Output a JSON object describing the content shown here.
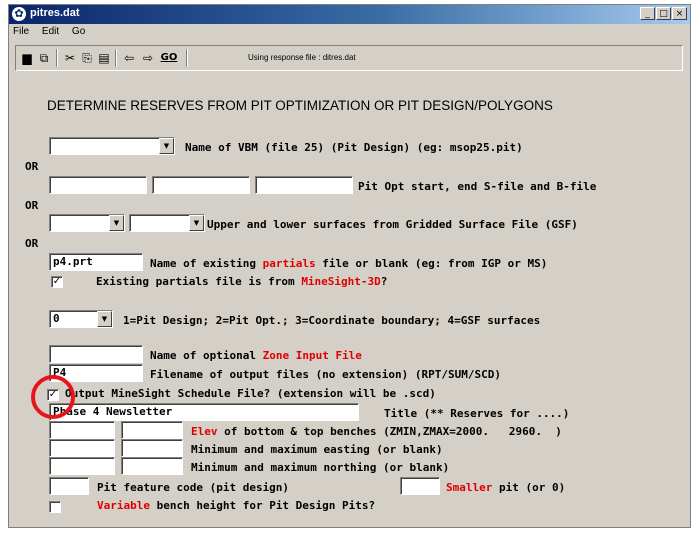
{
  "window": {
    "title": "pitres.dat",
    "controls": [
      "_",
      "□",
      "×"
    ]
  },
  "menu": [
    "File",
    "Edit",
    "Go"
  ],
  "toolbar": {
    "icons": [
      "save-icon",
      "open-icon",
      "cut-icon",
      "copy-icon",
      "paste-icon",
      "back-arrow-icon",
      "forward-arrow-icon",
      "go-icon"
    ],
    "go_label": "GO",
    "response_file": "Using response file : ditres.dat"
  },
  "heading": "DETERMINE RESERVES FROM PIT OPTIMIZATION OR PIT DESIGN/POLYGONS",
  "or_label": "OR",
  "vbm": {
    "value": "",
    "label": "Name of VBM (file 25) (Pit Design) (eg: msop25.pit)"
  },
  "pitopt": {
    "values": [
      "",
      "",
      ""
    ],
    "label": "Pit Opt start, end S-file and B-file"
  },
  "gsf": {
    "values": [
      "",
      ""
    ],
    "label": "Upper and lower surfaces from Gridded Surface File (GSF)"
  },
  "partials": {
    "value": "p4.prt",
    "label_a": "Name of existing ",
    "label_red": "partials",
    "label_b": " file or blank (eg: from IGP or MS)"
  },
  "partials_check": {
    "checked": true,
    "label_a": "Existing partials file is from ",
    "label_red": "MineSight-3D",
    "label_b": "?"
  },
  "boundary": {
    "value": "0",
    "label": "1=Pit Design; 2=Pit Opt.; 3=Coordinate boundary; 4=GSF surfaces"
  },
  "zone": {
    "value": "",
    "label_a": "Name of optional ",
    "label_red": "Zone Input File"
  },
  "output": {
    "value": "P4",
    "label": "Filename of output files (no extension) (RPT/SUM/SCD)"
  },
  "schedule": {
    "checked": true,
    "label": "Output MineSight Schedule File? (extension will be .scd)"
  },
  "title": {
    "value": "Phase 4 Newsletter",
    "label": "Title (** Reserves for ....)"
  },
  "elev": {
    "values": [
      "",
      ""
    ],
    "label_red": "Elev",
    "label": " of bottom & top benches (ZMIN,ZMAX=2000.   2960.  )"
  },
  "easting": {
    "values": [
      "",
      ""
    ],
    "label": "Minimum and maximum easting (or blank)"
  },
  "northing": {
    "values": [
      "",
      ""
    ],
    "label": "Minimum and maximum northing (or blank)"
  },
  "feature": {
    "value": "",
    "label": "Pit feature code (pit design)",
    "smaller_value": "",
    "smaller_red": "Smaller",
    "smaller_label": " pit (or 0)"
  },
  "variable": {
    "checked": false,
    "label_red": "Variable",
    "label": " bench height for Pit Design Pits?"
  }
}
